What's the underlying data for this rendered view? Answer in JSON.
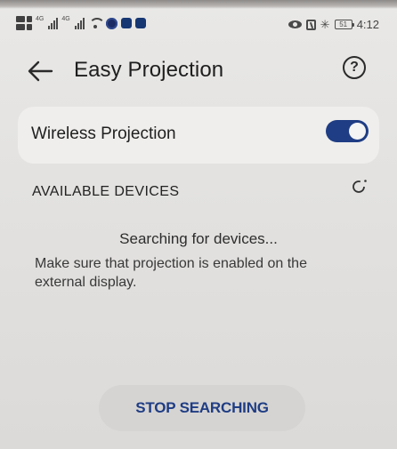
{
  "status_bar": {
    "signal_label_1": "4G",
    "signal_label_2": "4G",
    "battery": "51",
    "time": "4:12"
  },
  "header": {
    "title": "Easy Projection"
  },
  "wireless_projection": {
    "label": "Wireless Projection",
    "enabled": true
  },
  "available_devices": {
    "title": "AVAILABLE DEVICES"
  },
  "searching": {
    "status": "Searching for devices...",
    "hint": "Make sure that projection is enabled on the external display."
  },
  "actions": {
    "stop_label": "STOP SEARCHING"
  },
  "colors": {
    "accent": "#1f3d84",
    "background": "#e6e5e3",
    "card": "#efeeec"
  },
  "icons": {
    "back": "arrow-left-icon",
    "help": "help-icon",
    "refresh": "refresh-icon"
  }
}
